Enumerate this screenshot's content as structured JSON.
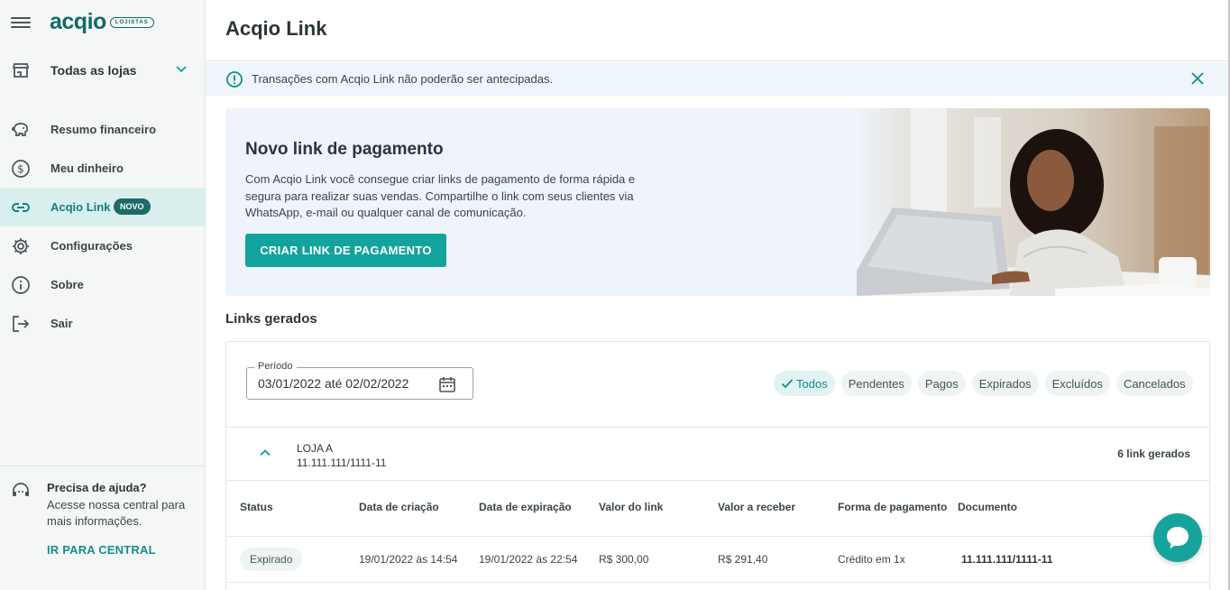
{
  "app": {
    "brand_name": "acqio",
    "brand_badge": "LOJISTAS"
  },
  "sidebar": {
    "store_selector": {
      "label": "Todas as lojas"
    },
    "items": [
      {
        "label": "Resumo financeiro",
        "icon": "piggy-bank-icon"
      },
      {
        "label": "Meu dinheiro",
        "icon": "dollar-circle-icon"
      },
      {
        "label": "Acqio Link",
        "icon": "link-icon",
        "badge": "NOVO",
        "active": true
      },
      {
        "label": "Configurações",
        "icon": "gear-icon"
      },
      {
        "label": "Sobre",
        "icon": "info-icon"
      },
      {
        "label": "Sair",
        "icon": "logout-icon"
      }
    ],
    "help": {
      "title": "Precisa de ajuda?",
      "description": "Acesse nossa central para mais informações.",
      "link": "IR PARA CENTRAL"
    }
  },
  "header": {
    "title": "Acqio Link"
  },
  "alert": {
    "text": "Transações com Acqio Link não poderão ser antecipadas."
  },
  "banner": {
    "title": "Novo link de pagamento",
    "description": "Com Acqio Link você consegue criar links de pagamento de forma rápida e segura para realizar suas vendas. Compartilhe o link com seus clientes via WhatsApp, e-mail ou qualquer canal de comunicação.",
    "cta": "CRIAR LINK DE PAGAMENTO"
  },
  "links_section": {
    "title": "Links gerados",
    "period": {
      "label": "Período",
      "value": "03/01/2022 até 02/02/2022"
    },
    "filters": [
      {
        "label": "Todos",
        "selected": true
      },
      {
        "label": "Pendentes",
        "selected": false
      },
      {
        "label": "Pagos",
        "selected": false
      },
      {
        "label": "Expirados",
        "selected": false
      },
      {
        "label": "Excluídos",
        "selected": false
      },
      {
        "label": "Cancelados",
        "selected": false
      }
    ],
    "store": {
      "name": "LOJA A",
      "cnpj": "11.111.111/1111-11",
      "count": "6 link gerados"
    },
    "table": {
      "headers": [
        "Status",
        "Data de criação",
        "Data de expiração",
        "Valor do link",
        "Valor a receber",
        "Forma de pagamento",
        "Documento"
      ],
      "rows": [
        {
          "status": "Expirado",
          "created": "19/01/2022 às 14:54",
          "expires": "19/01/2022 às 22:54",
          "amount": "R$ 300,00",
          "receivable": "R$ 291,40",
          "payment_method": "Crédito em 1x",
          "document": "11.111.111/1111-11"
        }
      ]
    }
  },
  "colors": {
    "brand": "#0f6c66",
    "accent": "#13a39d",
    "active_bg": "#d9efee",
    "banner_bg": "#eef4fa"
  }
}
